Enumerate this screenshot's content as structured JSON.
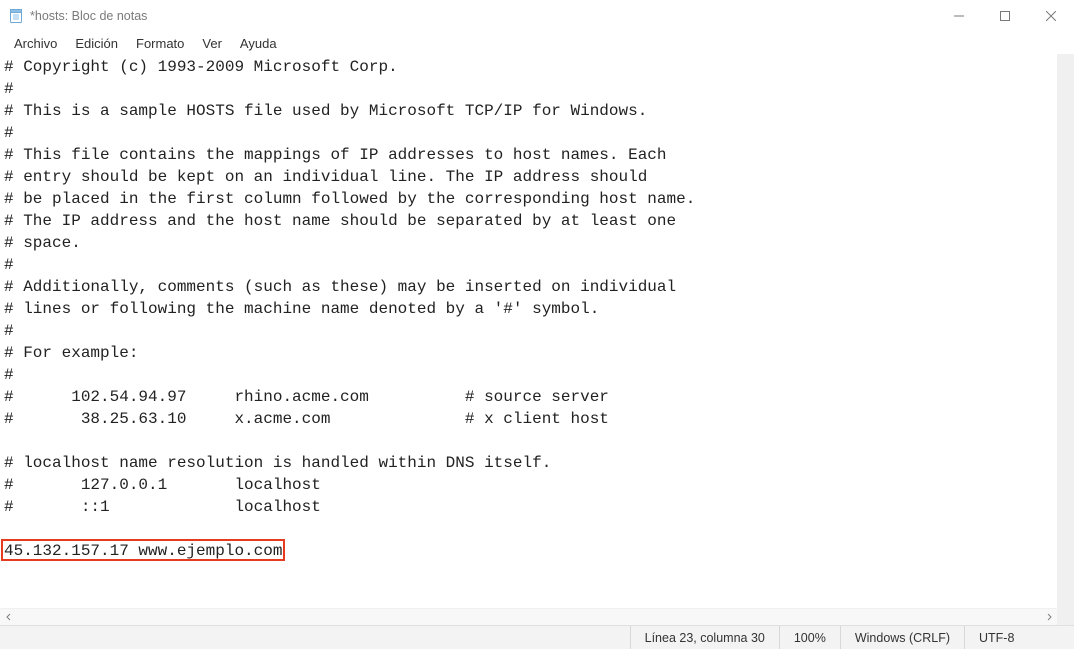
{
  "window": {
    "title": "*hosts: Bloc de notas"
  },
  "menu": {
    "archivo": "Archivo",
    "edicion": "Edición",
    "formato": "Formato",
    "ver": "Ver",
    "ayuda": "Ayuda"
  },
  "editor": {
    "lines": [
      "# Copyright (c) 1993-2009 Microsoft Corp.",
      "#",
      "# This is a sample HOSTS file used by Microsoft TCP/IP for Windows.",
      "#",
      "# This file contains the mappings of IP addresses to host names. Each",
      "# entry should be kept on an individual line. The IP address should",
      "# be placed in the first column followed by the corresponding host name.",
      "# The IP address and the host name should be separated by at least one",
      "# space.",
      "#",
      "# Additionally, comments (such as these) may be inserted on individual",
      "# lines or following the machine name denoted by a '#' symbol.",
      "#",
      "# For example:",
      "#",
      "#      102.54.94.97     rhino.acme.com          # source server",
      "#       38.25.63.10     x.acme.com              # x client host",
      "",
      "# localhost name resolution is handled within DNS itself.",
      "#\t127.0.0.1       localhost",
      "#\t::1             localhost",
      "",
      "45.132.157.17 www.ejemplo.com"
    ],
    "highlight_line_index": 22
  },
  "status": {
    "position": "Línea 23, columna 30",
    "zoom": "100%",
    "eol": "Windows (CRLF)",
    "encoding": "UTF-8"
  }
}
